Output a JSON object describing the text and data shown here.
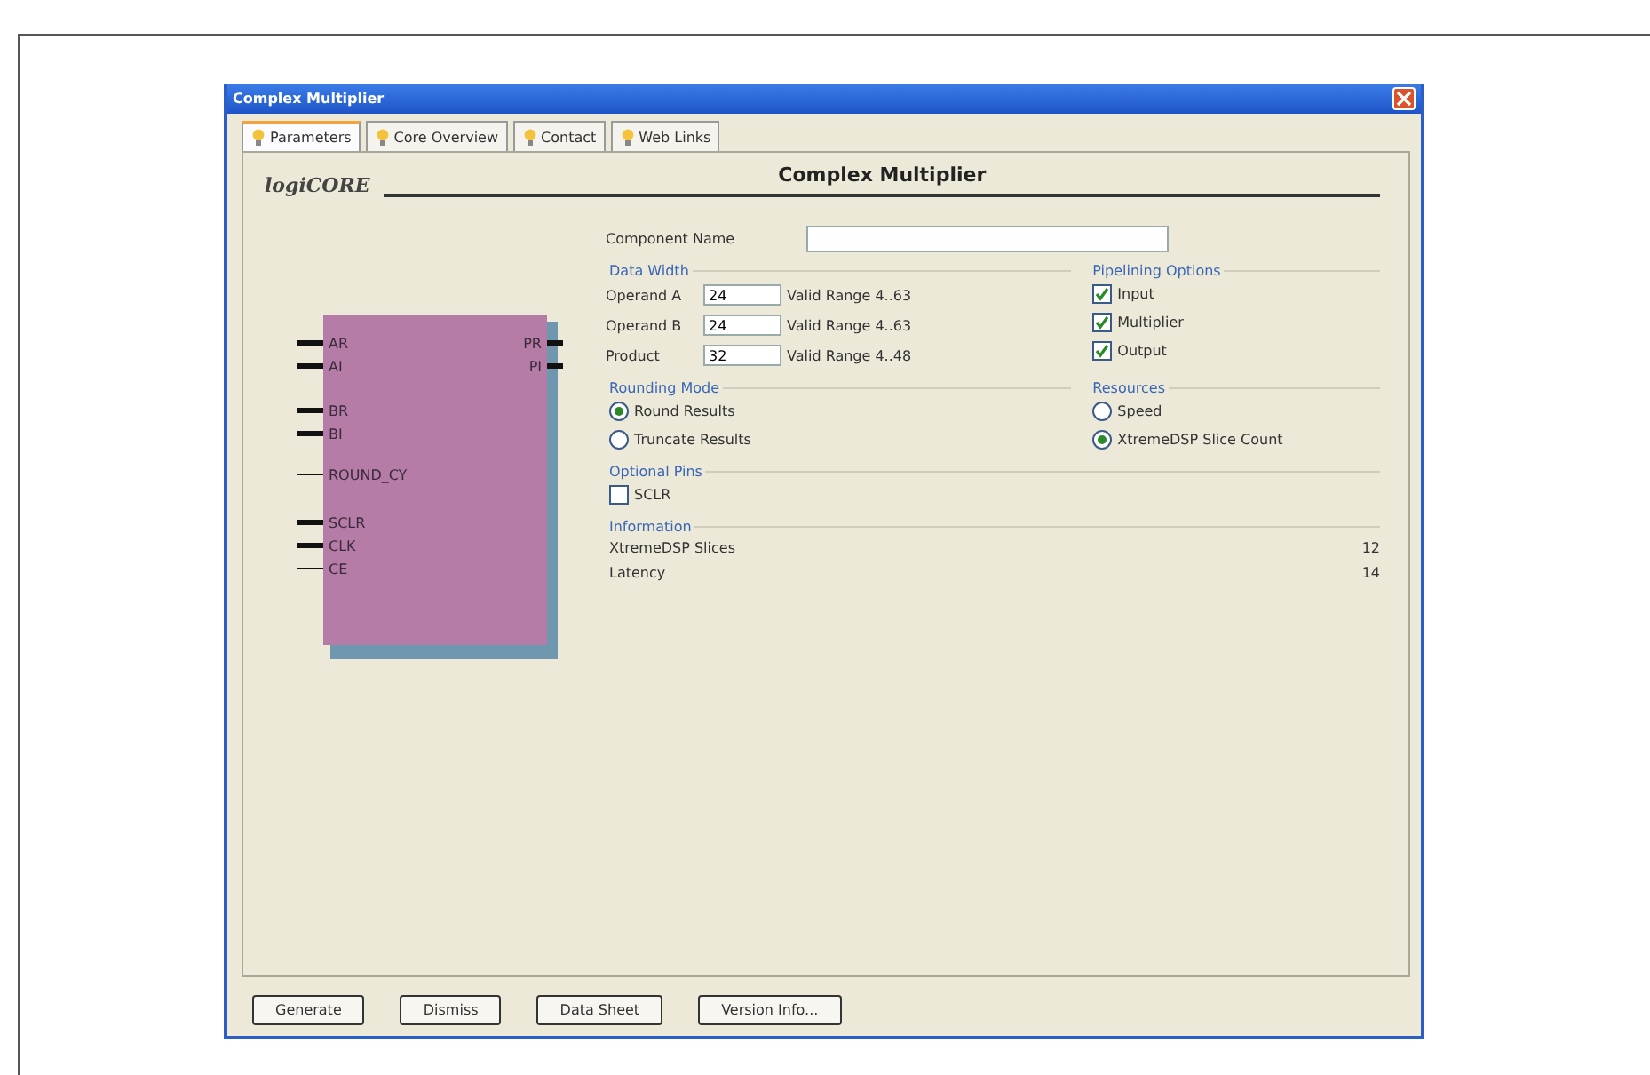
{
  "window": {
    "title": "Complex Multiplier"
  },
  "tabs": [
    {
      "label": "Parameters",
      "selected": true
    },
    {
      "label": "Core Overview",
      "selected": false
    },
    {
      "label": "Contact",
      "selected": false
    },
    {
      "label": "Web Links",
      "selected": false
    }
  ],
  "logo": {
    "text": "logiCORE"
  },
  "heading": "Complex Multiplier",
  "symbol": {
    "left_pins": [
      {
        "label": "AR",
        "kind": "bus"
      },
      {
        "label": "AI",
        "kind": "bus"
      },
      {
        "label": "BR",
        "kind": "bus"
      },
      {
        "label": "BI",
        "kind": "bus"
      },
      {
        "label": "ROUND_CY",
        "kind": "wire"
      },
      {
        "label": "SCLR",
        "kind": "bus"
      },
      {
        "label": "CLK",
        "kind": "bus"
      },
      {
        "label": "CE",
        "kind": "wire"
      }
    ],
    "right_pins": [
      {
        "label": "PR",
        "kind": "bus"
      },
      {
        "label": "PI",
        "kind": "bus"
      }
    ]
  },
  "component_name": {
    "label": "Component Name"
  },
  "data_width": {
    "title": "Data Width",
    "rows": [
      {
        "label": "Operand A",
        "value": "24",
        "range": "Valid Range 4..63"
      },
      {
        "label": "Operand B",
        "value": "24",
        "range": "Valid Range 4..63"
      },
      {
        "label": "Product",
        "value": "32",
        "range": "Valid Range 4..48"
      }
    ]
  },
  "pipelining": {
    "title": "Pipelining Options",
    "options": [
      {
        "label": "Input",
        "checked": true
      },
      {
        "label": "Multiplier",
        "checked": true
      },
      {
        "label": "Output",
        "checked": true
      }
    ]
  },
  "rounding": {
    "title": "Rounding Mode",
    "options": [
      {
        "label": "Round Results",
        "selected": true
      },
      {
        "label": "Truncate Results",
        "selected": false
      }
    ]
  },
  "resources": {
    "title": "Resources",
    "options": [
      {
        "label": "Speed",
        "selected": false
      },
      {
        "label": "XtremeDSP Slice Count",
        "selected": true
      }
    ]
  },
  "optional_pins": {
    "title": "Optional Pins",
    "options": [
      {
        "label": "SCLR",
        "checked": false
      }
    ]
  },
  "information": {
    "title": "Information",
    "rows": [
      {
        "label": "XtremeDSP Slices",
        "value": "12"
      },
      {
        "label": "Latency",
        "value": "14"
      }
    ]
  },
  "buttons": [
    "Generate",
    "Dismiss",
    "Data Sheet",
    "Version Info..."
  ]
}
